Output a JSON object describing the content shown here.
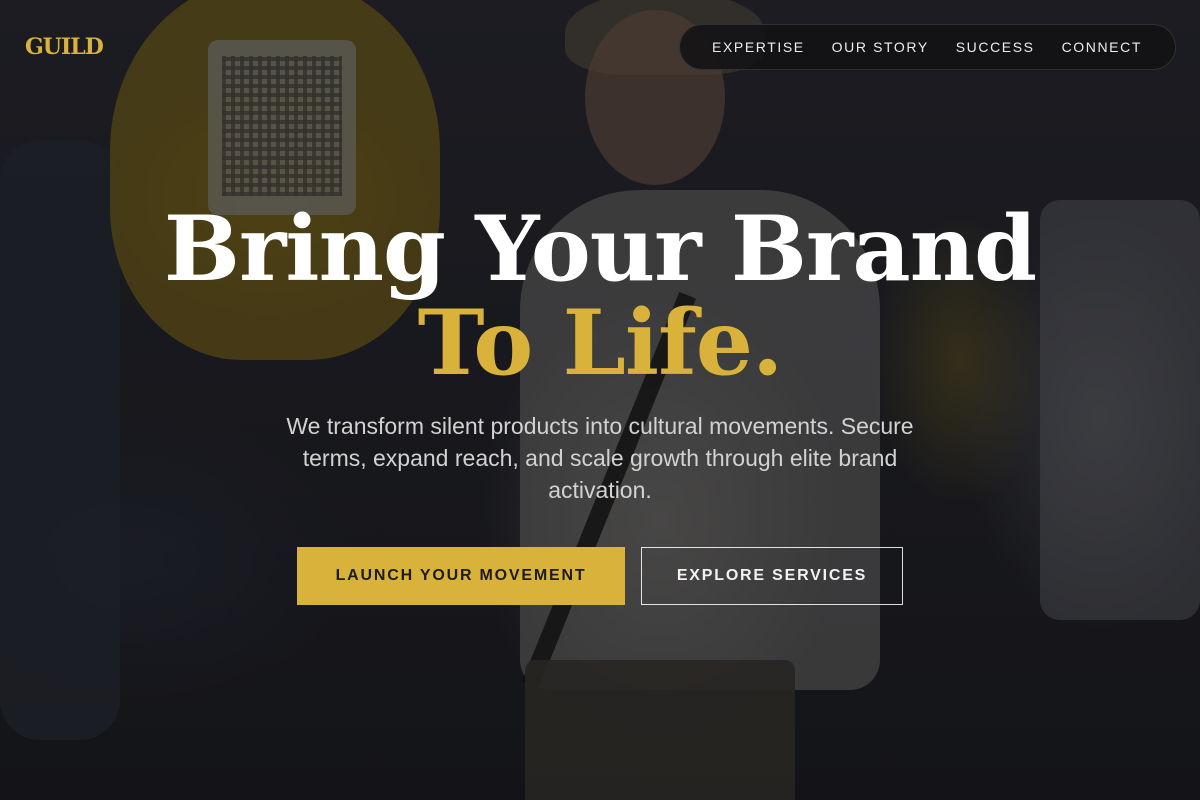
{
  "brand": {
    "logo_text": "GUILD",
    "accent_color": "#d8b23a"
  },
  "nav": {
    "items": [
      {
        "label": "EXPERTISE"
      },
      {
        "label": "OUR STORY"
      },
      {
        "label": "SUCCESS"
      },
      {
        "label": "CONNECT"
      }
    ]
  },
  "hero": {
    "headline_line1": "Bring Your Brand",
    "headline_line2": "To Life.",
    "subtitle": "We transform silent products into cultural movements. Secure terms, expand reach, and scale growth through elite brand activation.",
    "primary_cta": "LAUNCH YOUR MOVEMENT",
    "secondary_cta": "EXPLORE SERVICES"
  }
}
